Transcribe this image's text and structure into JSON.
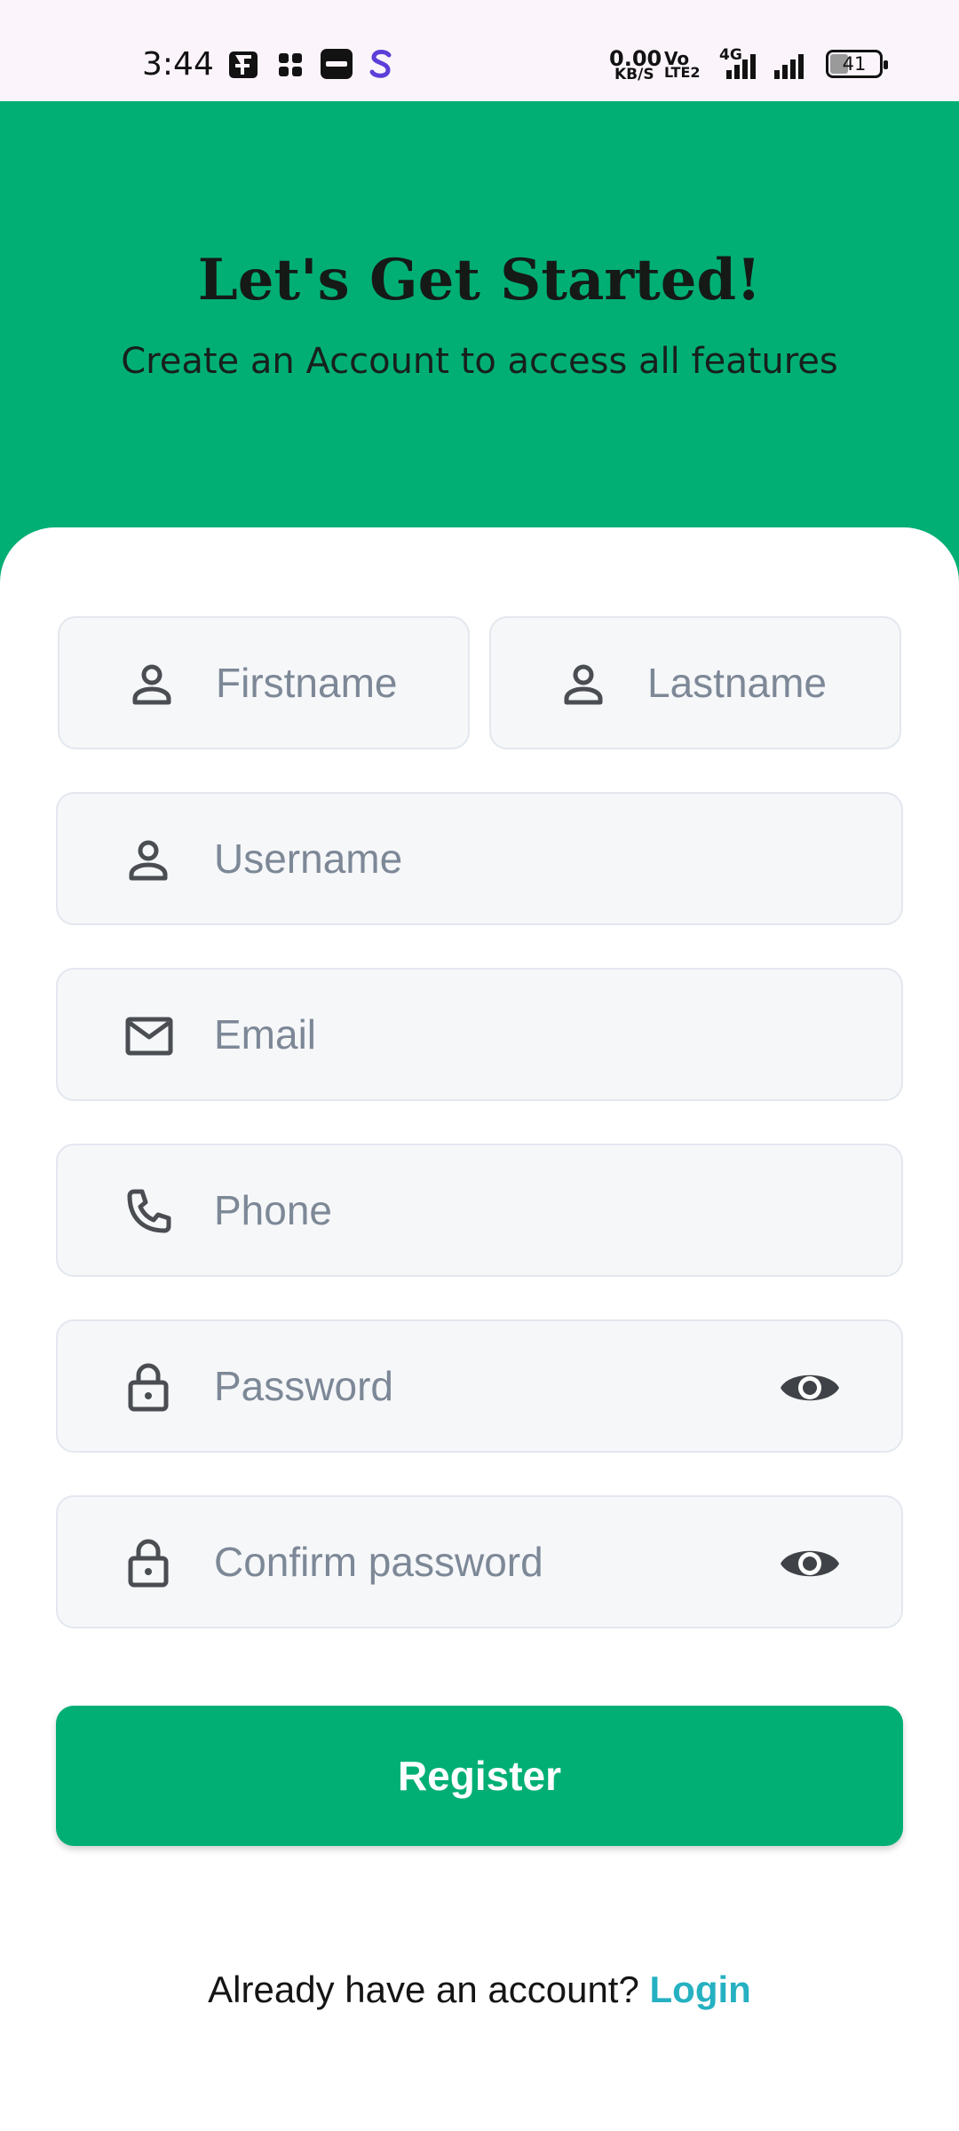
{
  "status_bar": {
    "time": "3:44",
    "net_speed_value": "0.00",
    "net_speed_unit": "KB/S",
    "volte_top": "Vo",
    "volte_bottom": "LTE2",
    "network_type": "4G",
    "battery": "41",
    "icons": [
      "gallery-icon",
      "apps-grid-icon",
      "paytm-icon",
      "s-app-icon",
      "signal-icon",
      "battery-icon"
    ]
  },
  "header": {
    "title": "Let's Get Started!",
    "subtitle": "Create an Account to access all features"
  },
  "form": {
    "firstname": {
      "placeholder": "Firstname",
      "value": "",
      "icon": "person-icon"
    },
    "lastname": {
      "placeholder": "Lastname",
      "value": "",
      "icon": "person-icon"
    },
    "username": {
      "placeholder": "Username",
      "value": "",
      "icon": "person-icon"
    },
    "email": {
      "placeholder": "Email",
      "value": "",
      "icon": "mail-icon"
    },
    "phone": {
      "placeholder": "Phone",
      "value": "",
      "icon": "phone-icon"
    },
    "password": {
      "placeholder": "Password",
      "value": "",
      "icon": "lock-icon"
    },
    "confirm_password": {
      "placeholder": "Confirm password",
      "value": "",
      "icon": "lock-icon"
    },
    "register_label": "Register"
  },
  "footer": {
    "prompt": "Already have an account?",
    "login_label": "Login"
  },
  "colors": {
    "primary": "#01af74",
    "link": "#25b1c2",
    "field_bg": "#f6f7f9",
    "placeholder": "#7d8897"
  }
}
